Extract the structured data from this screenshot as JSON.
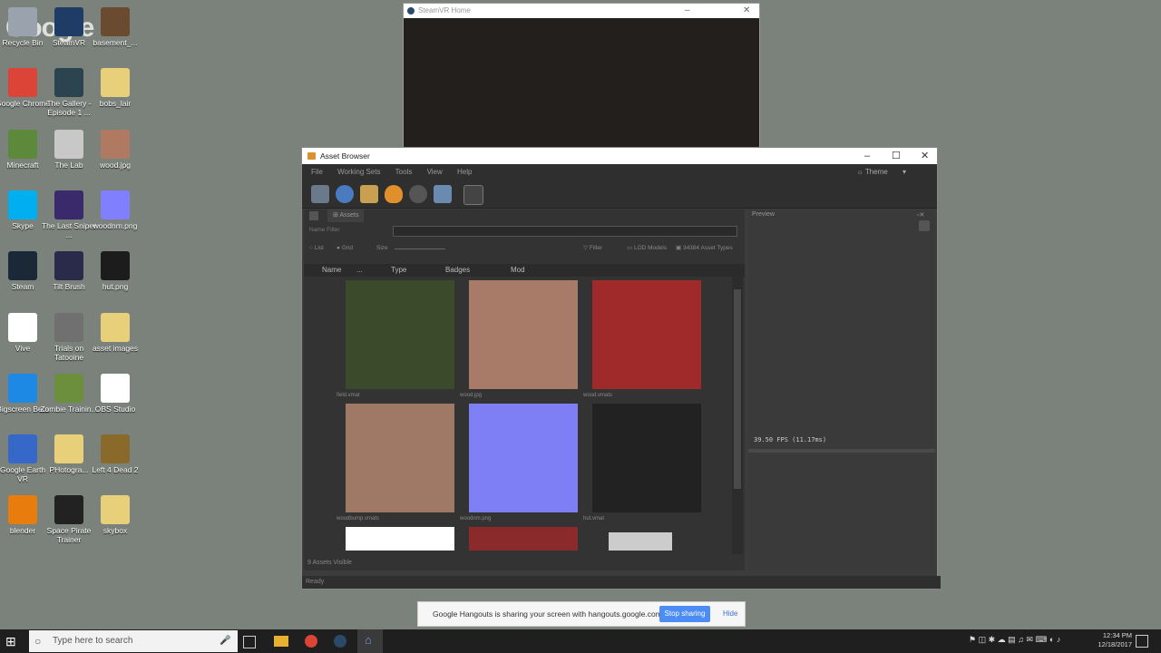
{
  "desktop": {
    "watermark": "Google",
    "icons": [
      {
        "label": "Recycle Bin",
        "color": "#9aa3ad"
      },
      {
        "label": "SteamVR",
        "color": "#1f3c66"
      },
      {
        "label": "basement_...",
        "color": "#6a4b30"
      },
      {
        "label": "Google Chrome",
        "color": "#db4437"
      },
      {
        "label": "The Gallery - Episode 1 ...",
        "color": "#2c4450"
      },
      {
        "label": "bobs_lair",
        "color": "#e8cf7a"
      },
      {
        "label": "Minecraft",
        "color": "#5c8a3a"
      },
      {
        "label": "The Lab",
        "color": "#c8c8c8"
      },
      {
        "label": "wood.jpg",
        "color": "#b07a62"
      },
      {
        "label": "Skype",
        "color": "#00aff0"
      },
      {
        "label": "The Last Sniper ...",
        "color": "#3b2a6b"
      },
      {
        "label": "woodnm.png",
        "color": "#8080ff"
      },
      {
        "label": "Steam",
        "color": "#1b2838"
      },
      {
        "label": "Tilt Brush",
        "color": "#2a2a4a"
      },
      {
        "label": "hut.png",
        "color": "#1c1c1c"
      },
      {
        "label": "Vive",
        "color": "#ffffff"
      },
      {
        "label": "Trials on Tatooine",
        "color": "#707070"
      },
      {
        "label": "asset images",
        "color": "#e8cf7a"
      },
      {
        "label": "Bigscreen Beta",
        "color": "#1e88e5"
      },
      {
        "label": "Zombie Trainin...",
        "color": "#6b8f3c"
      },
      {
        "label": "OBS Studio",
        "color": "#ffffff"
      },
      {
        "label": "Google Earth VR",
        "color": "#3568c8"
      },
      {
        "label": "PHotogra...",
        "color": "#e8cf7a"
      },
      {
        "label": "Left 4 Dead 2",
        "color": "#8a6a2a"
      },
      {
        "label": "blender",
        "color": "#e87d0d"
      },
      {
        "label": "Space Pirate Trainer",
        "color": "#222222"
      },
      {
        "label": "skybox",
        "color": "#e8cf7a"
      }
    ]
  },
  "steamvr_window": {
    "title": "SteamVR Home"
  },
  "asset_browser": {
    "title": "Asset Browser",
    "menu": [
      "File",
      "Working Sets",
      "Tools",
      "View",
      "Help"
    ],
    "theme_label": "Theme",
    "tab_assets": "Assets",
    "name_filter_label": "Name Filter",
    "name_filter_value": "",
    "view_list": "List",
    "view_grid": "Grid",
    "size_label": "Size",
    "filter_label": "Filter",
    "lod_label": "LOD Models",
    "asset_types_label": "34384 Asset Types",
    "columns": [
      "Name",
      "...",
      "Type",
      "Badges",
      "Mod"
    ],
    "tiles": [
      {
        "label": "field.vmat",
        "color": "#3b4a2a"
      },
      {
        "label": "wood.jpg",
        "color": "#a87a68"
      },
      {
        "label": "wood.vmats",
        "color": "#a02a2a"
      },
      {
        "label": "woodbump.vmats",
        "color": "#a07866"
      },
      {
        "label": "woodnm.png",
        "color": "#7f7ff5"
      },
      {
        "label": "hut.vmat",
        "color": "#222222"
      },
      {
        "label": "",
        "color": "#ffffff"
      },
      {
        "label": "",
        "color": "#8a2a2a"
      },
      {
        "label": "",
        "color": "#cccccc"
      }
    ],
    "assets_visible": "9 Assets Visible",
    "preview_title": "Preview",
    "fps_text": "39.50 FPS (11.17ms)",
    "status": "Ready"
  },
  "hangouts": {
    "message": "Google Hangouts is sharing your screen with hangouts.google.com.",
    "stop_label": "Stop sharing",
    "hide_label": "Hide"
  },
  "taskbar": {
    "search_placeholder": "Type here to search",
    "time": "12:34 PM",
    "date": "12/18/2017"
  }
}
